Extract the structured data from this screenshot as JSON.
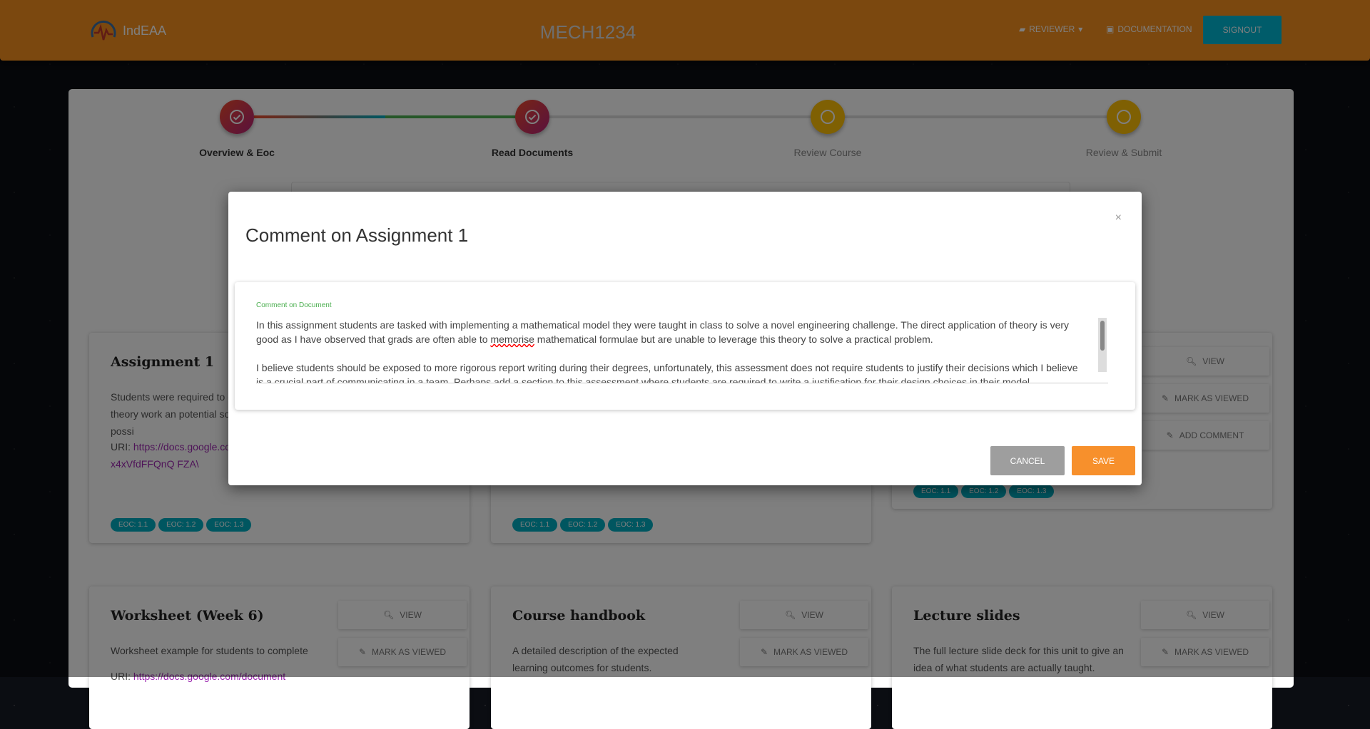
{
  "header": {
    "brand": "IndEAA",
    "course": "MECH1234",
    "reviewer": "REVIEWER",
    "documentation": "DOCUMENTATION",
    "signout": "SIGNOUT"
  },
  "stepper": [
    {
      "label": "Overview & Eoc",
      "done": true
    },
    {
      "label": "Read Documents",
      "done": true
    },
    {
      "label": "Review Course",
      "done": false
    },
    {
      "label": "Review & Submit",
      "done": false
    }
  ],
  "cards": [
    {
      "title": "Assignment 1",
      "description": "Students were required to d engineering theory work an potential solutions to possi",
      "uri_label": "URI:",
      "uri": "https://docs.google.co /d/1FYgSDfx4xVfdFFQnQ FZA\\",
      "eocs": [
        "EOC: 1.1",
        "EOC: 1.2",
        "EOC: 1.3"
      ]
    },
    {
      "eocs": [
        "EOC: 1.1",
        "EOC: 1.2",
        "EOC: 1.3"
      ]
    },
    {
      "buttons": [
        "VIEW",
        "MARK AS VIEWED",
        "ADD COMMENT"
      ],
      "eocs": [
        "EOC: 1.1",
        "EOC: 1.2",
        "EOC: 1.3"
      ]
    },
    {
      "title": "Worksheet (Week 6)",
      "description": "Worksheet example for students to complete",
      "uri_label": "URI:",
      "uri": "https://docs.google.com/document",
      "buttons": [
        "VIEW",
        "MARK AS VIEWED"
      ]
    },
    {
      "title": "Course handbook",
      "description": "A detailed description of the expected learning outcomes for students.",
      "buttons": [
        "VIEW",
        "MARK AS VIEWED"
      ]
    },
    {
      "title": "Lecture slides",
      "description": "The full lecture slide deck for this unit to give an idea of what students are actually taught.",
      "buttons": [
        "VIEW",
        "MARK AS VIEWED"
      ]
    }
  ],
  "modal": {
    "title": "Comment on Assignment 1",
    "close": "×",
    "field_label": "Comment on Document",
    "comment_p1a": "In this assignment students are tasked with implementing a mathematical model they were taught in class to solve a novel engineering challenge. The direct application of theory is very good as I have observed that grads are often able to ",
    "comment_misspelled": "memorise",
    "comment_p1b": " mathematical formulae but are unable to leverage this theory to solve a practical problem.",
    "comment_p2": "I believe students should be exposed to more rigorous report writing during their degrees, unfortunately, this assessment does not require students to justify their decisions which I believe is a crucial part of communicating in a team. Perhaps add a section to this assessment where students are required to write a justification for their design choices in their model.",
    "cancel": "CANCEL",
    "save": "SAVE"
  },
  "colors": {
    "header": "#f7901e",
    "signout": "#00b8d4",
    "chip": "#00acc1",
    "save": "#f7902c",
    "step_done": "#e03a4a",
    "step_todo": "#ffc107"
  }
}
